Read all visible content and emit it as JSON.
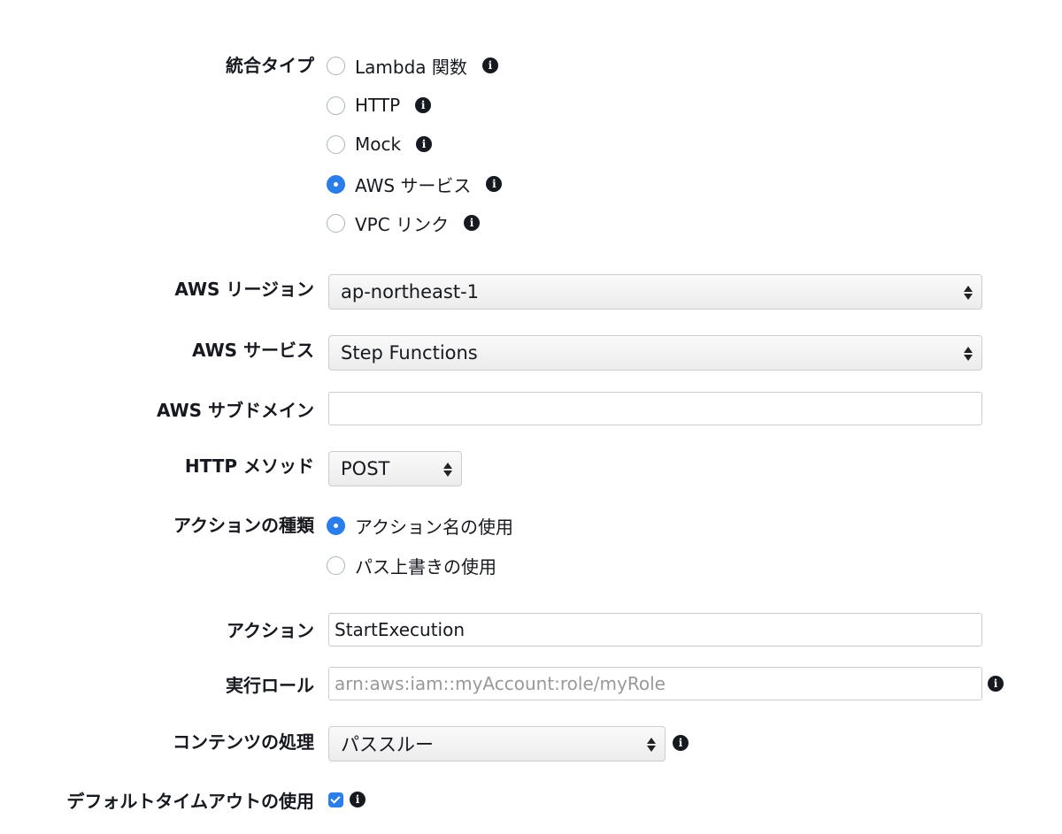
{
  "integration_type": {
    "label": "統合タイプ",
    "options": [
      {
        "label": "Lambda 関数",
        "checked": false
      },
      {
        "label": "HTTP",
        "checked": false
      },
      {
        "label": "Mock",
        "checked": false
      },
      {
        "label": "AWS サービス",
        "checked": true
      },
      {
        "label": "VPC リンク",
        "checked": false
      }
    ]
  },
  "region": {
    "label": "AWS リージョン",
    "value": "ap-northeast-1"
  },
  "service": {
    "label": "AWS サービス",
    "value": "Step Functions"
  },
  "subdomain": {
    "label": "AWS サブドメイン",
    "value": ""
  },
  "http_method": {
    "label": "HTTP メソッド",
    "value": "POST"
  },
  "action_type": {
    "label": "アクションの種類",
    "options": [
      {
        "label": "アクション名の使用",
        "checked": true
      },
      {
        "label": "パス上書きの使用",
        "checked": false
      }
    ]
  },
  "action": {
    "label": "アクション",
    "value": "StartExecution"
  },
  "execution_role": {
    "label": "実行ロール",
    "placeholder": "arn:aws:iam::myAccount:role/myRole",
    "value": ""
  },
  "content_handling": {
    "label": "コンテンツの処理",
    "value": "パススルー"
  },
  "default_timeout": {
    "label": "デフォルトタイムアウトの使用",
    "checked": true
  },
  "icons": {
    "info": "info-icon",
    "select_arrows": "select-arrows-icon"
  },
  "colors": {
    "accent": "#2b7de9",
    "text": "#16191f",
    "border": "#c9ced3"
  }
}
